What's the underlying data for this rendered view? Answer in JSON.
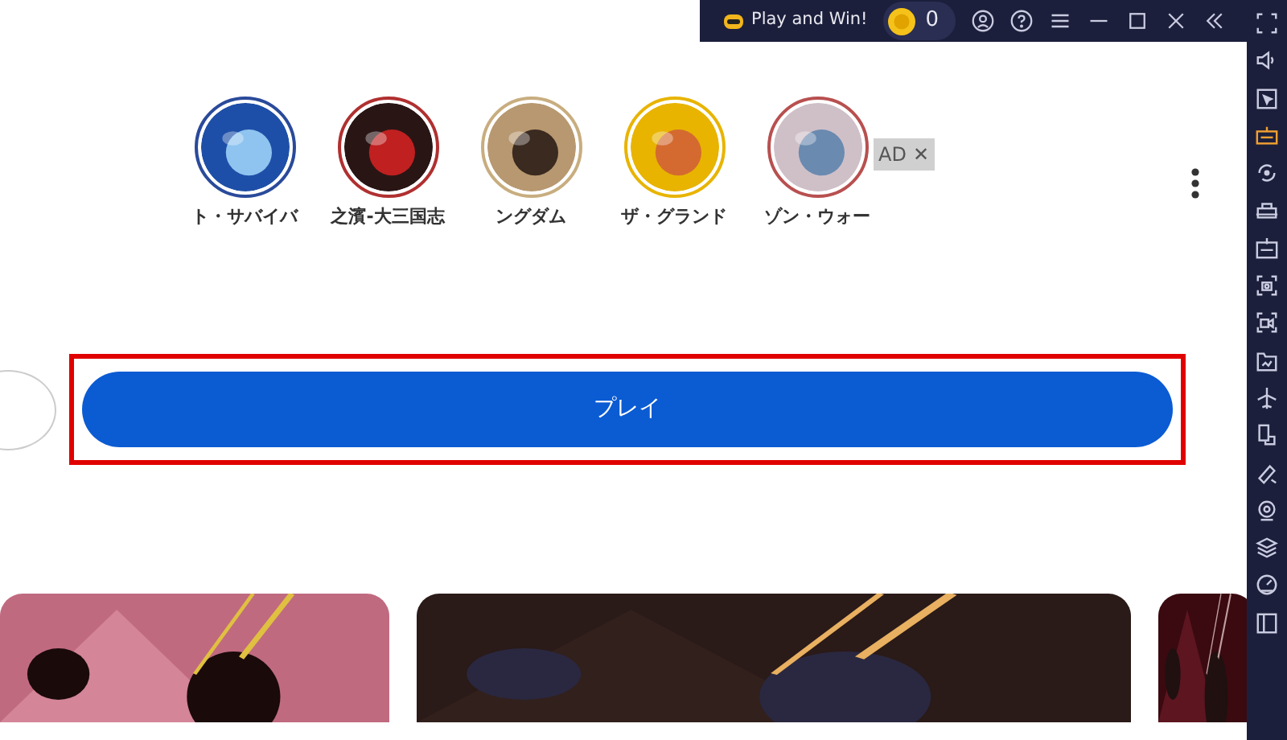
{
  "title_bar": {
    "promo": "Play and Win!",
    "coins": "0"
  },
  "games": [
    {
      "label": "ト・サバイバ",
      "color": "#2a4a9a"
    },
    {
      "label": "之濱-大三国志",
      "color": "#b03030"
    },
    {
      "label": "ングダム",
      "color": "#c8ad7f"
    },
    {
      "label": "ザ・グランド",
      "color": "#e8b400"
    },
    {
      "label": "ゾン・ウォー",
      "color": "#b85050"
    }
  ],
  "ad_badge": {
    "label": "AD",
    "close": "✕"
  },
  "play_button": {
    "label": "プレイ",
    "highlighted": true
  }
}
